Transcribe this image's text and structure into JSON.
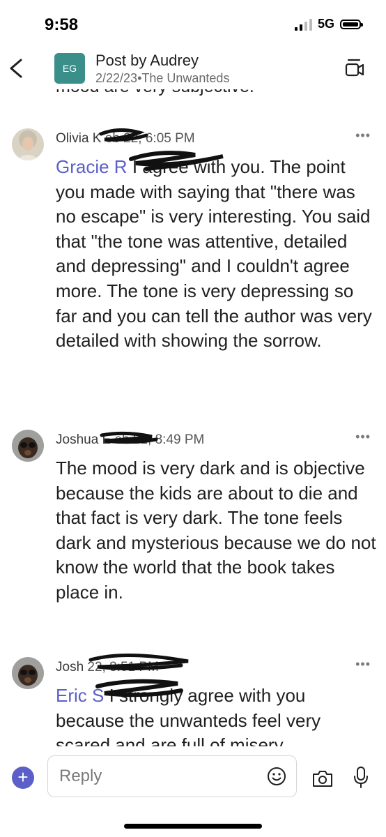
{
  "status_bar": {
    "time": "9:58",
    "network": "5G"
  },
  "header": {
    "back_icon": "chevron-left-icon",
    "group_initials": "EG",
    "title": "Post by Audrey",
    "date": "2/22/23",
    "separator": "•",
    "channel": "The Unwanteds",
    "meet_icon": "video-meeting-icon",
    "colors": {
      "group_avatar": "#3a8f8a"
    }
  },
  "feed": {
    "cut_previous_text": "mood are very subjective.",
    "messages": [
      {
        "author": "Olivia K",
        "timestamp": "eb 22, 6:05 PM",
        "mention": "Gracie R",
        "text": "I agree with you. The point you made with saying that \"there was no escape\" is very interesting. You said that \"the tone was attentive, detailed and depressing\" and I couldn't agree more. The tone is very depressing so far and you can tell the author was very detailed with showing the sorrow.",
        "more": "•••"
      },
      {
        "author": "Joshua E",
        "timestamp": "eb 22, 8:49 PM",
        "mention": "",
        "text": "The mood is very dark and is objective because the kids are about to die and that fact is very dark. The tone feels dark and mysterious because we do not know the world that the book takes place in.",
        "more": "•••"
      },
      {
        "author": "Josh",
        "timestamp": "22, 8:51 PM",
        "mention": "Eric S",
        "text": "I strongly agree with you because the unwanteds feel very scared and are full of misery",
        "more": "•••"
      }
    ]
  },
  "composer": {
    "placeholder": "Reply",
    "plus_label": "+",
    "emoji_icon": "emoji-icon",
    "camera_icon": "camera-icon",
    "mic_icon": "microphone-icon",
    "colors": {
      "accent": "#5b5fc7"
    }
  }
}
